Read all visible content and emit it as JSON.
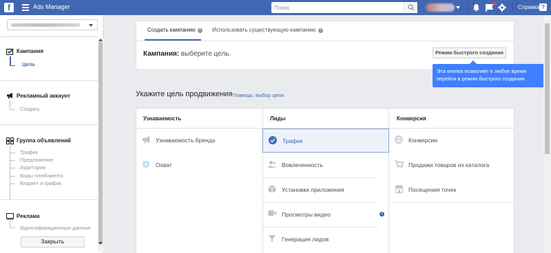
{
  "topbar": {
    "logo": "f",
    "app_title": "Ads Manager",
    "search_placeholder": "Поиск",
    "help_label": "Справка",
    "help_icon": "?",
    "icons": [
      "menu-icon",
      "search-icon",
      "bell-icon",
      "flag-icon",
      "gear-icon"
    ]
  },
  "sidebar": {
    "close_label": "Закрыть",
    "sections": {
      "campaign": {
        "title": "Кампания",
        "items": [
          "Цель"
        ]
      },
      "ad_account": {
        "title": "Рекламный аккаунт",
        "items": [
          "Создать"
        ]
      },
      "ad_set": {
        "title": "Группа объявлений",
        "items": [
          "Трафик",
          "Предложение",
          "Аудитория",
          "Виды плейсмента",
          "Бюджет и график"
        ]
      },
      "ad": {
        "title": "Реклама",
        "items": [
          "Идентификационные данные"
        ]
      }
    }
  },
  "card": {
    "tab_create": "Создать кампанию",
    "tab_existing": "Использовать существующую кампанию",
    "campaign_label": "Кампания:",
    "campaign_hint": "выберите цель.",
    "quick_button": "Режим быстрого создания"
  },
  "tooltip": {
    "text": "Эта кнопка позволяет в любое время перейти в режим быстрого создания.",
    "close": "×"
  },
  "goals": {
    "title": "Укажите цель продвижения",
    "help": "Помощь: выбор цели",
    "columns": [
      {
        "heading": "Узнаваемость",
        "options": [
          "Узнаваемость бренда",
          "Охват"
        ]
      },
      {
        "heading": "Лиды",
        "options": [
          "Трафик",
          "Вовлеченность",
          "Установки приложения",
          "Просмотры видео",
          "Генерация лидов"
        ]
      },
      {
        "heading": "Конверсия",
        "options": [
          "Конверсии",
          "Продажи товаров из каталога",
          "Посещения точек"
        ]
      }
    ],
    "selected": "Трафик",
    "info_badge": "i",
    "accent_color": "#4267b2"
  }
}
